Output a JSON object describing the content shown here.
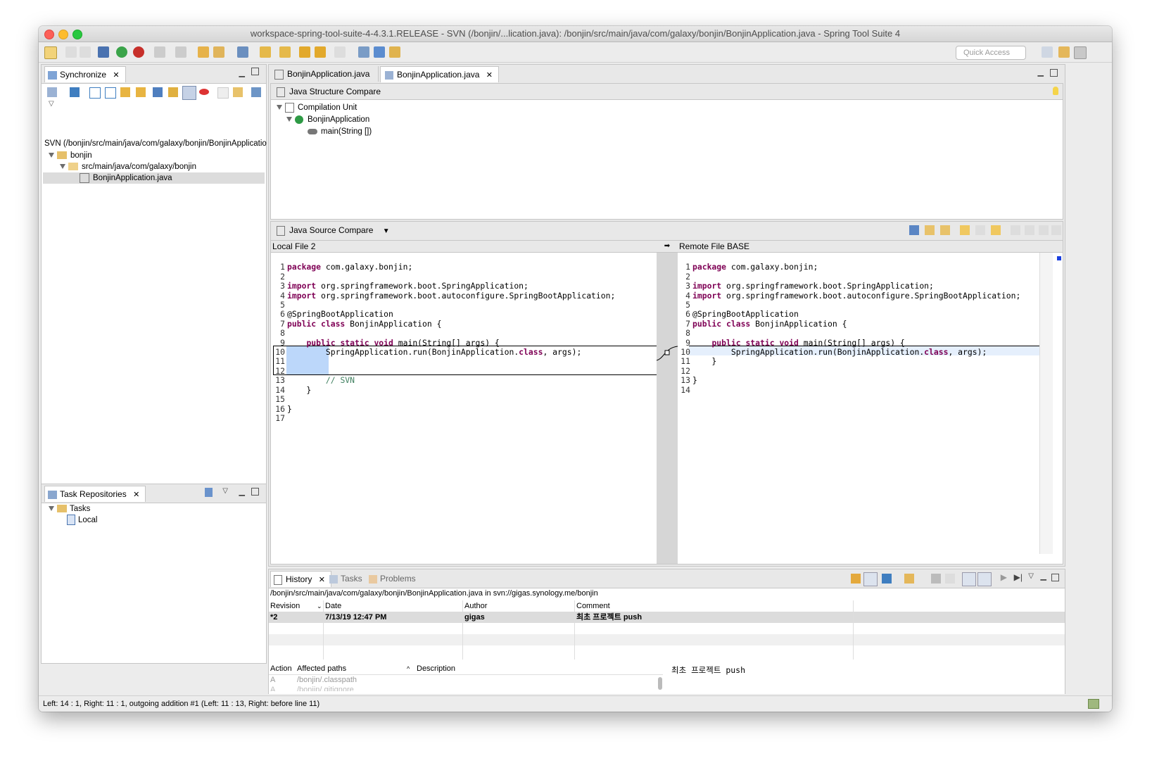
{
  "window": {
    "title": "workspace-spring-tool-suite-4-4.3.1.RELEASE - SVN (/bonjin/...lication.java): /bonjin/src/main/java/com/galaxy/bonjin/BonjinApplication.java - Spring Tool Suite 4"
  },
  "toolbar": {
    "quick_access_placeholder": "Quick Access"
  },
  "synchronize": {
    "tab_label": "Synchronize",
    "root": "SVN (/bonjin/src/main/java/com/galaxy/bonjin/BonjinApplicatio",
    "project": "bonjin",
    "package": "src/main/java/com/galaxy/bonjin",
    "file": "BonjinApplication.java"
  },
  "task_repositories": {
    "tab_label": "Task Repositories",
    "folder": "Tasks",
    "repo": "Local"
  },
  "editor_tabs": [
    {
      "label": "BonjinApplication.java"
    },
    {
      "label": "BonjinApplication.java"
    }
  ],
  "structure_compare": {
    "title": "Java Structure Compare",
    "items": [
      "Compilation Unit",
      "BonjinApplication",
      "main(String [])"
    ]
  },
  "source_compare": {
    "title": "Java Source Compare",
    "left_label": "Local File 2",
    "right_label": "Remote File BASE",
    "left_lines": [
      "package com.galaxy.bonjin;",
      "",
      "import org.springframework.boot.SpringApplication;",
      "import org.springframework.boot.autoconfigure.SpringBootApplication;",
      "",
      "@SpringBootApplication",
      "public class BonjinApplication {",
      "",
      "    public static void main(String[] args) {",
      "        SpringApplication.run(BonjinApplication.class, args);",
      "",
      "",
      "        // SVN",
      "    }",
      "",
      "}",
      ""
    ],
    "right_lines": [
      "package com.galaxy.bonjin;",
      "",
      "import org.springframework.boot.SpringApplication;",
      "import org.springframework.boot.autoconfigure.SpringBootApplication;",
      "",
      "@SpringBootApplication",
      "public class BonjinApplication {",
      "",
      "    public static void main(String[] args) {",
      "        SpringApplication.run(BonjinApplication.class, args);",
      "    }",
      "",
      "}",
      ""
    ]
  },
  "bottom_tabs": {
    "history": "History",
    "tasks": "Tasks",
    "problems": "Problems"
  },
  "history": {
    "path": "/bonjin/src/main/java/com/galaxy/bonjin/BonjinApplication.java in svn://gigas.synology.me/bonjin",
    "columns": [
      "Revision",
      "Date",
      "Author",
      "Comment"
    ],
    "rows": [
      {
        "revision": "*2",
        "date": "7/13/19 12:47 PM",
        "author": "gigas",
        "comment": "최초 프로젝트 push"
      }
    ],
    "paths_columns": [
      "Action",
      "Affected paths",
      "Description"
    ],
    "paths_rows": [
      {
        "action": "A",
        "path": "/bonjin/.classpath"
      },
      {
        "action": "A",
        "path": "/bonjin/.gitignore"
      }
    ],
    "comment_detail": "최초 프로젝트 push"
  },
  "status": {
    "text": "Left: 14 : 1, Right: 11 : 1, outgoing addition #1 (Left: 11 : 13, Right: before line 11)"
  }
}
